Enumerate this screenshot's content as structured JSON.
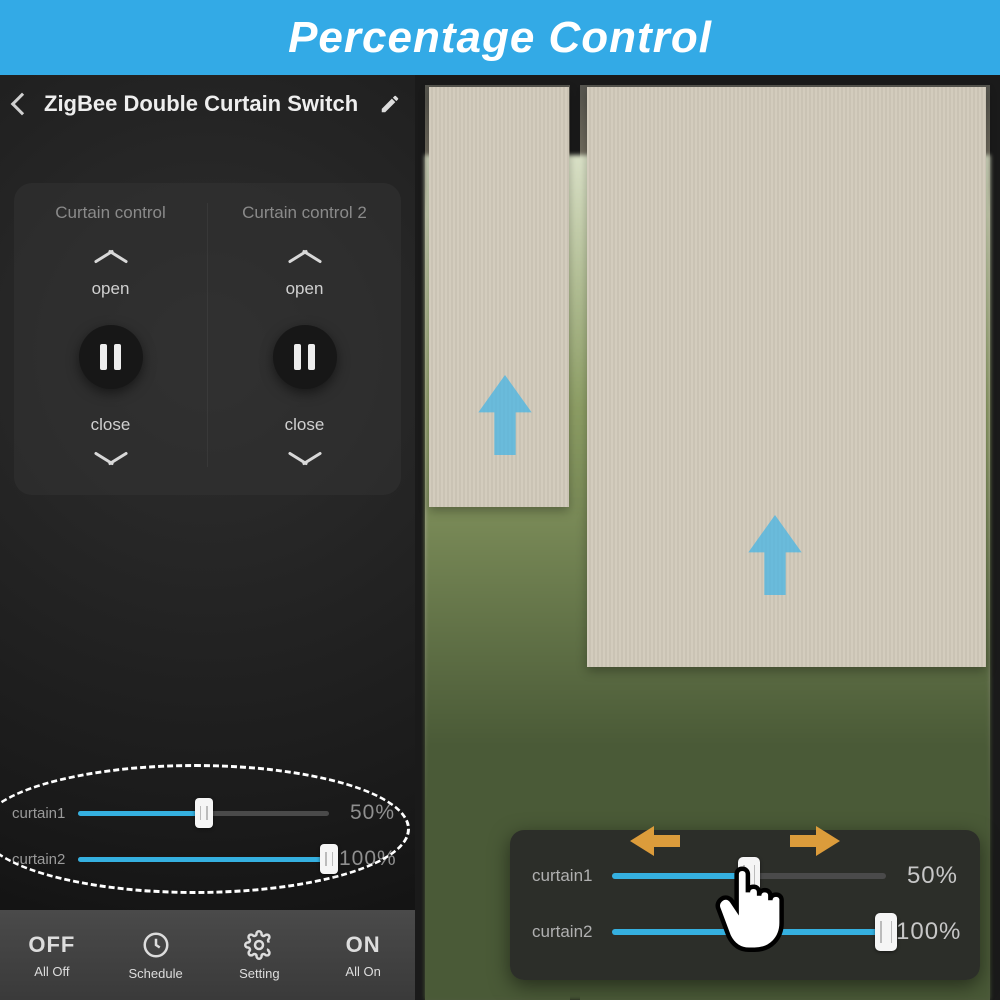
{
  "banner": {
    "title": "Percentage Control"
  },
  "app": {
    "title": "ZigBee Double Curtain Switch",
    "controls": [
      {
        "title": "Curtain control",
        "open": "open",
        "close": "close"
      },
      {
        "title": "Curtain control 2",
        "open": "open",
        "close": "close"
      }
    ],
    "sliders": [
      {
        "label": "curtain1",
        "percent": 50,
        "display": "50%"
      },
      {
        "label": "curtain2",
        "percent": 100,
        "display": "100%"
      }
    ],
    "bottom": {
      "all_off_big": "OFF",
      "all_off": "All Off",
      "schedule": "Schedule",
      "setting": "Setting",
      "all_on_big": "ON",
      "all_on": "All On"
    }
  },
  "callout": {
    "sliders": [
      {
        "label": "curtain1",
        "percent": 50,
        "display": "50%"
      },
      {
        "label": "curtain2",
        "percent": 100,
        "display": "100%"
      }
    ]
  }
}
